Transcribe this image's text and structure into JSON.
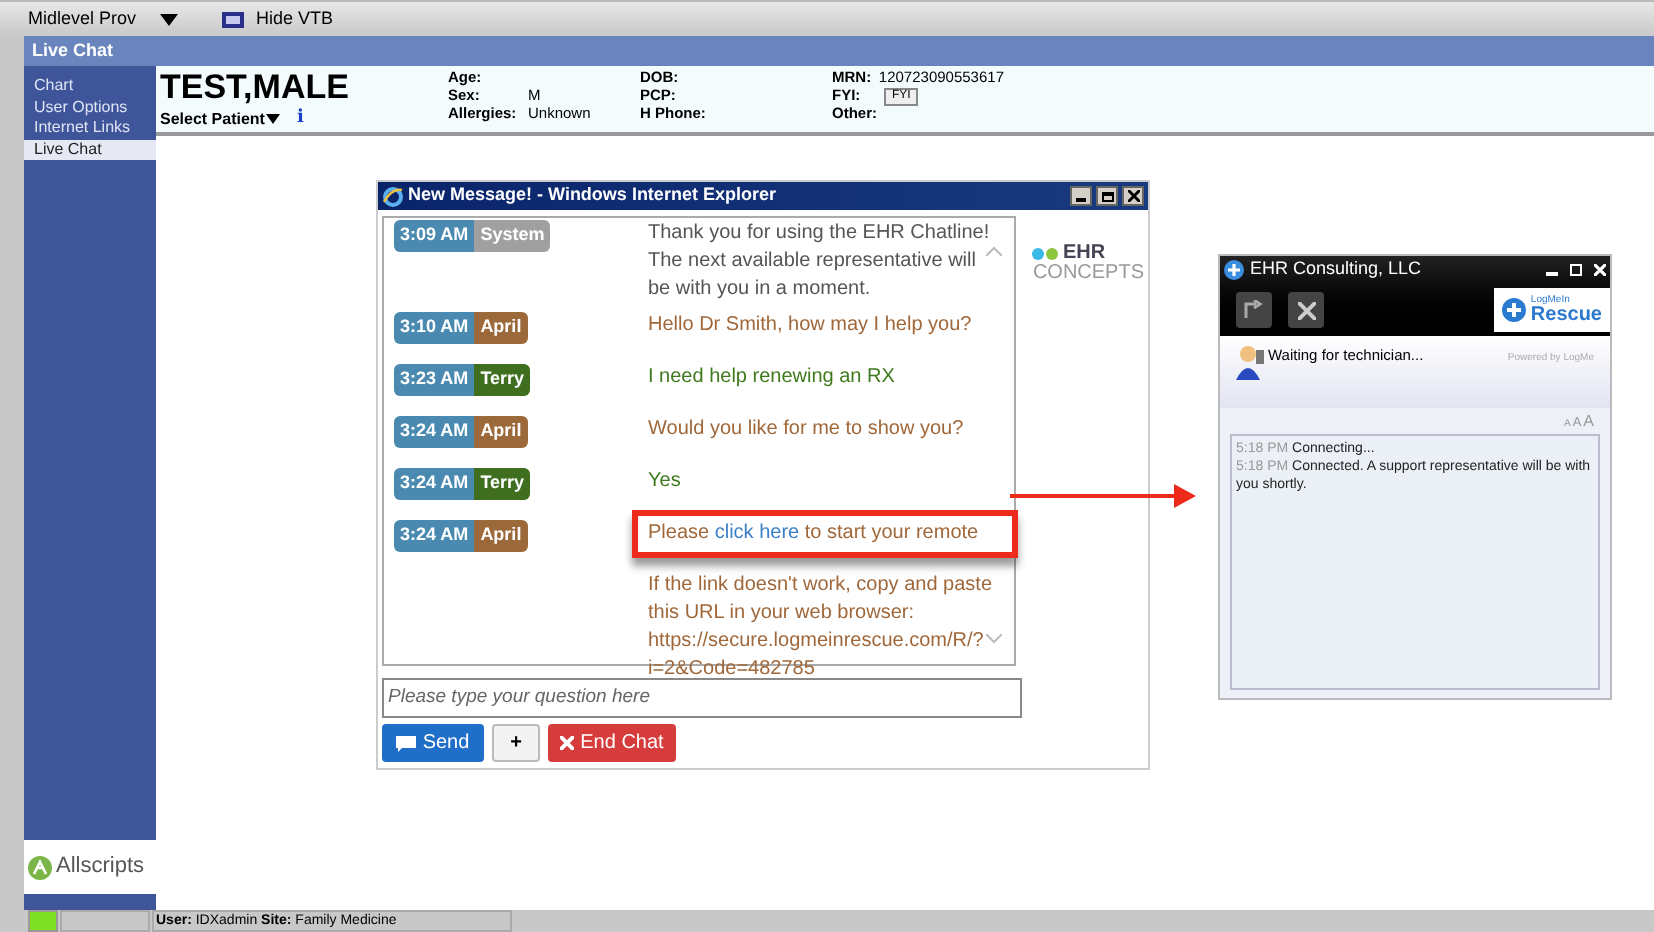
{
  "toolbar": {
    "provider": "Midlevel Prov",
    "hide_button": "Hide VTB"
  },
  "title_bar": {
    "title": "Live Chat"
  },
  "sidebar": {
    "items": [
      {
        "label": "Chart",
        "selected": false
      },
      {
        "label": "User Options",
        "selected": false
      },
      {
        "label": "Internet Links",
        "selected": false
      },
      {
        "label": "Live Chat",
        "selected": true
      }
    ],
    "logo": "Allscripts"
  },
  "patient": {
    "name": "TEST,MALE",
    "select_label": "Select Patient",
    "info_icon": "i",
    "fields": [
      {
        "label": "Age:"
      },
      {
        "label": "Sex:",
        "value": "M"
      },
      {
        "label": "Allergies:",
        "value": "Unknown"
      },
      {
        "label": "DOB:"
      },
      {
        "label": "PCP:"
      },
      {
        "label": "H Phone:"
      },
      {
        "label": "MRN:",
        "value": "120723090553617"
      },
      {
        "label": "FYI:",
        "value": "FYI",
        "kind": "button"
      },
      {
        "label": "Other:"
      }
    ]
  },
  "chat_window": {
    "title": "New Message! - Windows Internet Explorer",
    "messages": [
      {
        "time": "3:09 AM",
        "sender": "System",
        "kind": "system",
        "text": "Thank you for using the EHR Chatline! The next available representative will be with you in a moment."
      },
      {
        "time": "3:10 AM",
        "sender": "April",
        "kind": "agent",
        "text": "Hello Dr Smith, how may I help you?"
      },
      {
        "time": "3:23 AM",
        "sender": "Terry",
        "kind": "user",
        "text": "I need help renewing an RX"
      },
      {
        "time": "3:24 AM",
        "sender": "April",
        "kind": "agent",
        "text": "Would you like for me to show you?"
      },
      {
        "time": "3:24 AM",
        "sender": "Terry",
        "kind": "user",
        "text": "Yes"
      },
      {
        "time": "3:24 AM",
        "sender": "April",
        "kind": "agent",
        "text": "Please",
        "link": "click here",
        "text_after": "to start your remote",
        "highlighted": true,
        "continuation": "If the link doesn't work, copy and paste this URL in your web browser: https://secure.logmeinrescue.com/R/?i=2&Code=482785"
      }
    ],
    "logo": {
      "top": "EHR",
      "bottom": "CONCEPTS"
    },
    "input": {
      "placeholder": "Please type your question here"
    },
    "buttons": [
      {
        "label": "Send",
        "kind": "send"
      },
      {
        "label": "+",
        "kind": "plus"
      },
      {
        "label": "End Chat",
        "kind": "end"
      }
    ]
  },
  "rescue_window": {
    "title": "EHR Consulting, LLC",
    "brand_top": "LogMeIn",
    "brand": "Rescue",
    "status": "Waiting for technician...",
    "powered": "Powered by LogMe",
    "font_sizes": [
      "A",
      "A",
      "A"
    ],
    "log": [
      {
        "time": "5:18 PM",
        "text": "Connecting..."
      },
      {
        "time": "5:18 PM",
        "text": "Connected. A support representative will be with you shortly."
      }
    ]
  },
  "status_bar": {
    "user_label": "User:",
    "user": "IDXadmin",
    "site_label": "Site:",
    "site": "Family Medicine"
  }
}
